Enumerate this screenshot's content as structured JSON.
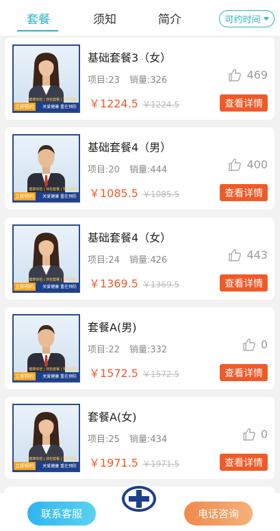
{
  "tabs": [
    {
      "label": "套餐",
      "active": true
    },
    {
      "label": "须知",
      "active": false
    },
    {
      "label": "简介",
      "active": false
    }
  ],
  "time_filter": {
    "label": "可约时间",
    "icon": "caret-down-icon"
  },
  "promo": {
    "badge": "立即预约",
    "slogan": "关爱健康 重在预防",
    "tags": "健康体检 | 体检套餐 | 预约体检"
  },
  "packages": [
    {
      "title": "基础套餐3（女）",
      "items_label": "项目:23",
      "sales_label": "销量:326",
      "price": "￥1224.5",
      "original_price": "￥1224.5",
      "likes": "469",
      "button": "查看详情",
      "gender": "female"
    },
    {
      "title": "基础套餐4（男）",
      "items_label": "项目:20",
      "sales_label": "销量:444",
      "price": "￥1085.5",
      "original_price": "￥1085.5",
      "likes": "400",
      "button": "查看详情",
      "gender": "male"
    },
    {
      "title": "基础套餐4（女）",
      "items_label": "项目:24",
      "sales_label": "销量:426",
      "price": "￥1369.5",
      "original_price": "￥1369.5",
      "likes": "443",
      "button": "查看详情",
      "gender": "female"
    },
    {
      "title": "套餐A(男)",
      "items_label": "项目:22",
      "sales_label": "销量:332",
      "price": "￥1572.5",
      "original_price": "￥1572.5",
      "likes": "0",
      "button": "查看详情",
      "gender": "male"
    },
    {
      "title": "套餐A(女)",
      "items_label": "项目:25",
      "sales_label": "销量:434",
      "price": "￥1971.5",
      "original_price": "￥1971.5",
      "likes": "0",
      "button": "查看详情",
      "gender": "female"
    }
  ],
  "bottom": {
    "service_label": "联系客服",
    "phone_label": "电话咨询",
    "logo_icon": "hospital-cross-logo"
  },
  "colors": {
    "accent": "#2bb3c0",
    "price": "#f05a28",
    "detail_button": "#f05a28",
    "service_button": "#2eb6f0",
    "phone_button": "#f08a4b"
  }
}
